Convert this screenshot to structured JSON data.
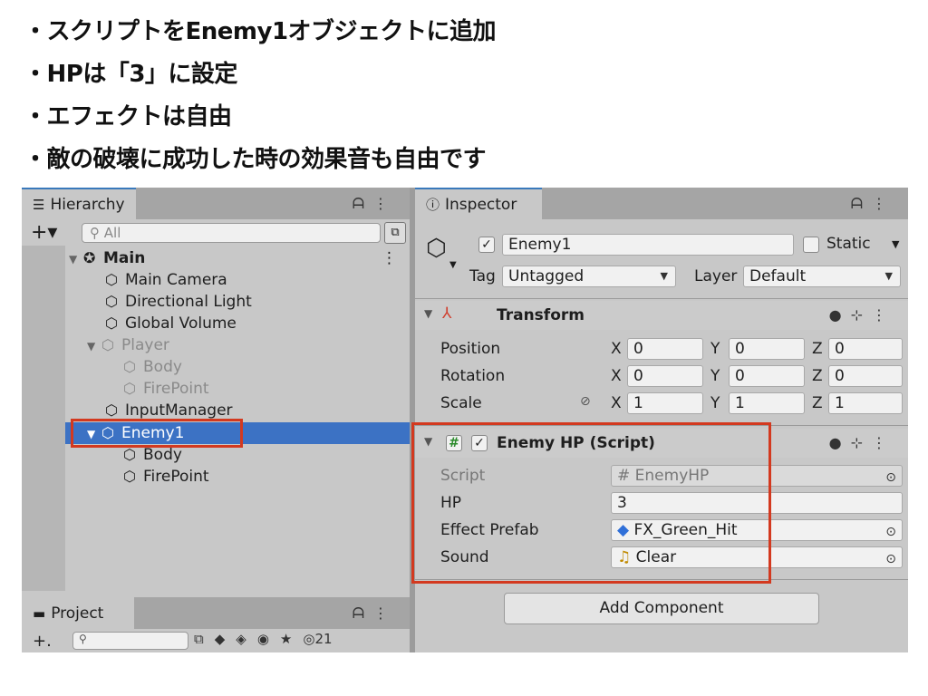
{
  "notes": [
    "・スクリプトをEnemy1オブジェクトに追加",
    "・HPは「3」に設定",
    "・エフェクトは自由",
    "・敵の破壊に成功した時の効果音も自由です"
  ],
  "hierarchy": {
    "tab_label": "Hierarchy",
    "plus": "+▾",
    "search_placeholder": "All",
    "rows": [
      {
        "name": "Main",
        "arrow": "▼"
      },
      {
        "name": "Main Camera"
      },
      {
        "name": "Directional Light"
      },
      {
        "name": "Global Volume"
      },
      {
        "name": "Player",
        "arrow": "▼"
      },
      {
        "name": "Body"
      },
      {
        "name": "FirePoint"
      },
      {
        "name": "InputManager"
      },
      {
        "name": "Enemy1",
        "arrow": "▼"
      },
      {
        "name": "Body"
      },
      {
        "name": "FirePoint"
      }
    ]
  },
  "project": {
    "tab_label": "Project",
    "plus": "+.",
    "count": "21"
  },
  "inspector": {
    "tab_label": "Inspector",
    "object_name": "Enemy1",
    "static_label": "Static",
    "tag_label": "Tag",
    "tag_value": "Untagged",
    "layer_label": "Layer",
    "layer_value": "Default",
    "transform": {
      "title": "Transform",
      "rows": [
        {
          "label": "Position",
          "x": "0",
          "y": "0",
          "z": "0"
        },
        {
          "label": "Rotation",
          "x": "0",
          "y": "0",
          "z": "0"
        },
        {
          "label": "Scale",
          "x": "1",
          "y": "1",
          "z": "1"
        }
      ],
      "axis_x": "X",
      "axis_y": "Y",
      "axis_z": "Z"
    },
    "script_component": {
      "title": "Enemy HP (Script)",
      "script_label": "Script",
      "script_value": "EnemyHP",
      "hp_label": "HP",
      "hp_value": "3",
      "effect_label": "Effect Prefab",
      "effect_value": "FX_Green_Hit",
      "sound_label": "Sound",
      "sound_value": "Clear"
    },
    "add_component": "Add Component"
  }
}
